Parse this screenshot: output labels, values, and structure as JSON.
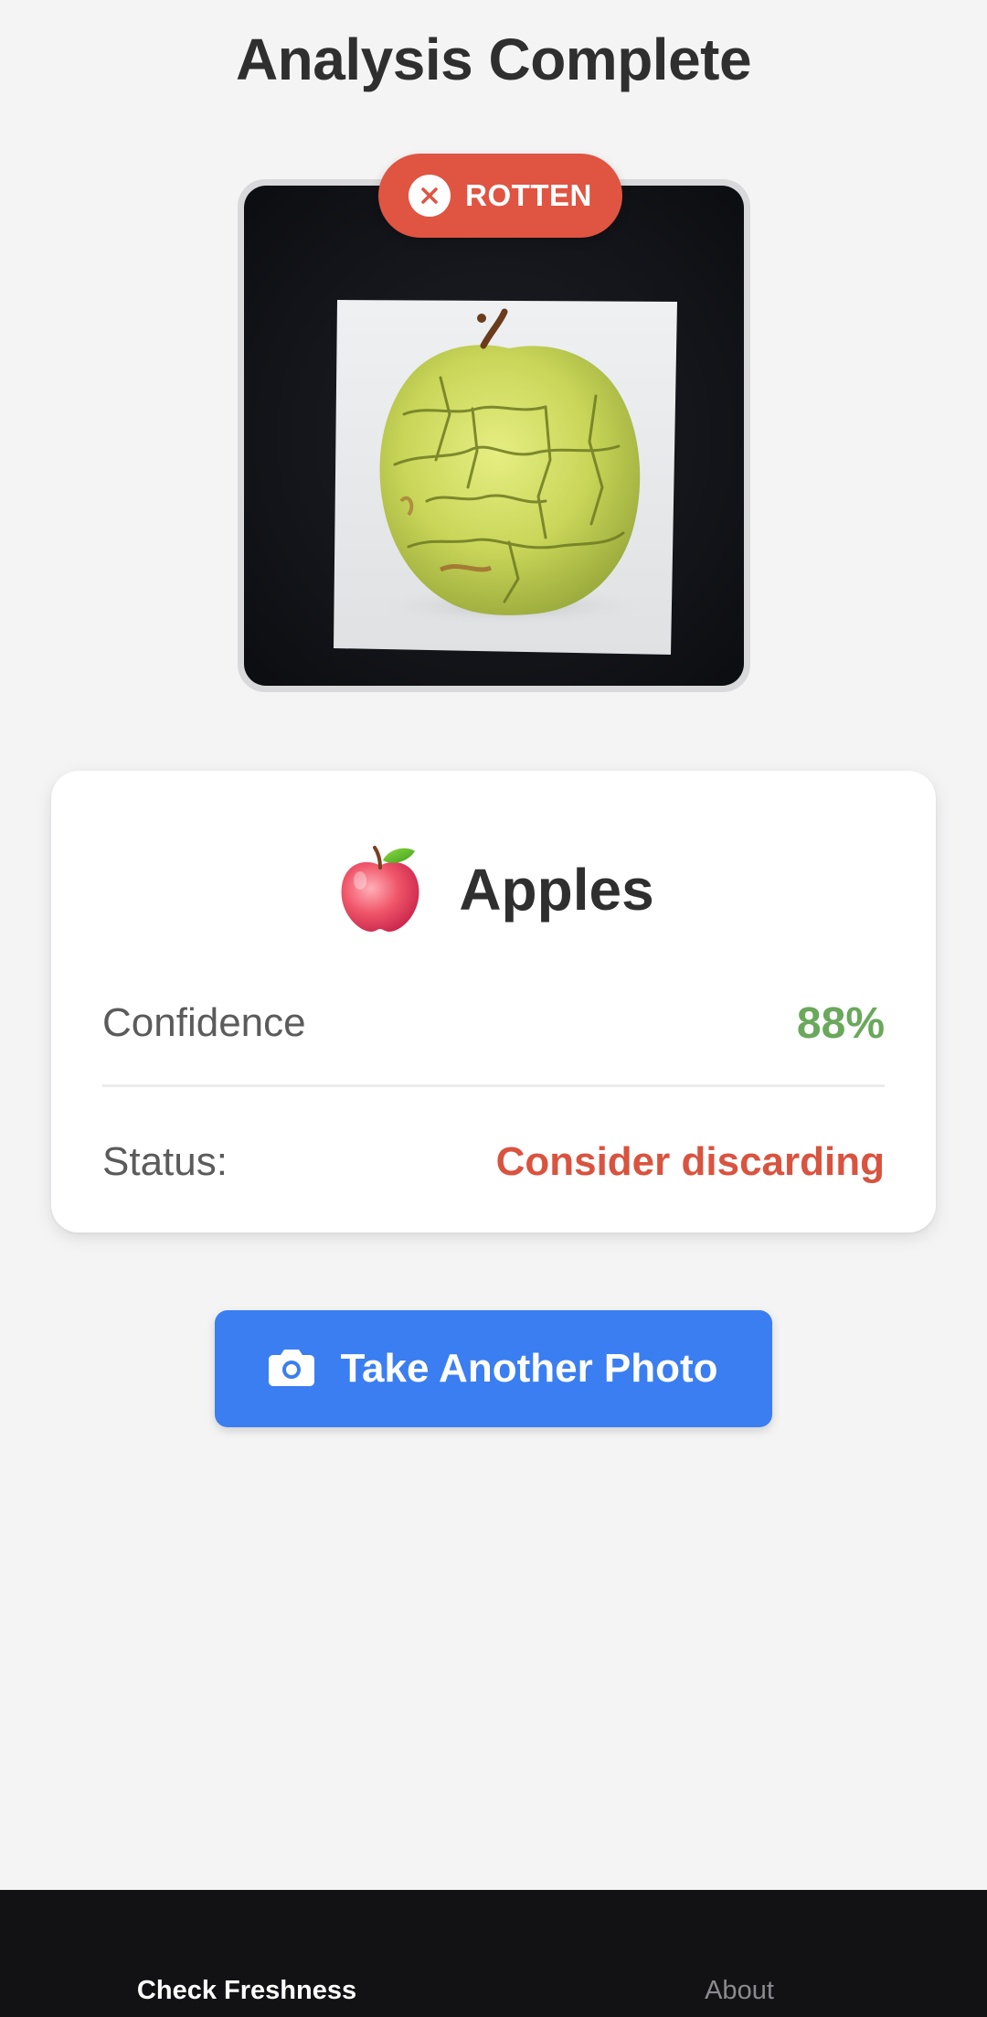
{
  "header": {
    "title": "Analysis Complete"
  },
  "result_badge": {
    "label": "ROTTEN",
    "icon": "close-icon",
    "color": "#e05442"
  },
  "photo": {
    "subject": "apple-photo"
  },
  "result_card": {
    "produce_emoji": "🍎",
    "produce_name": "Apples",
    "confidence_label": "Confidence",
    "confidence_value": "88%",
    "status_label": "Status:",
    "status_value": "Consider discarding"
  },
  "actions": {
    "take_another_label": "Take Another Photo",
    "icon": "camera-icon",
    "color": "#3a7ef1"
  },
  "bottom_nav": {
    "items": [
      {
        "label": "Check Freshness",
        "active": true
      },
      {
        "label": "About",
        "active": false
      }
    ]
  }
}
